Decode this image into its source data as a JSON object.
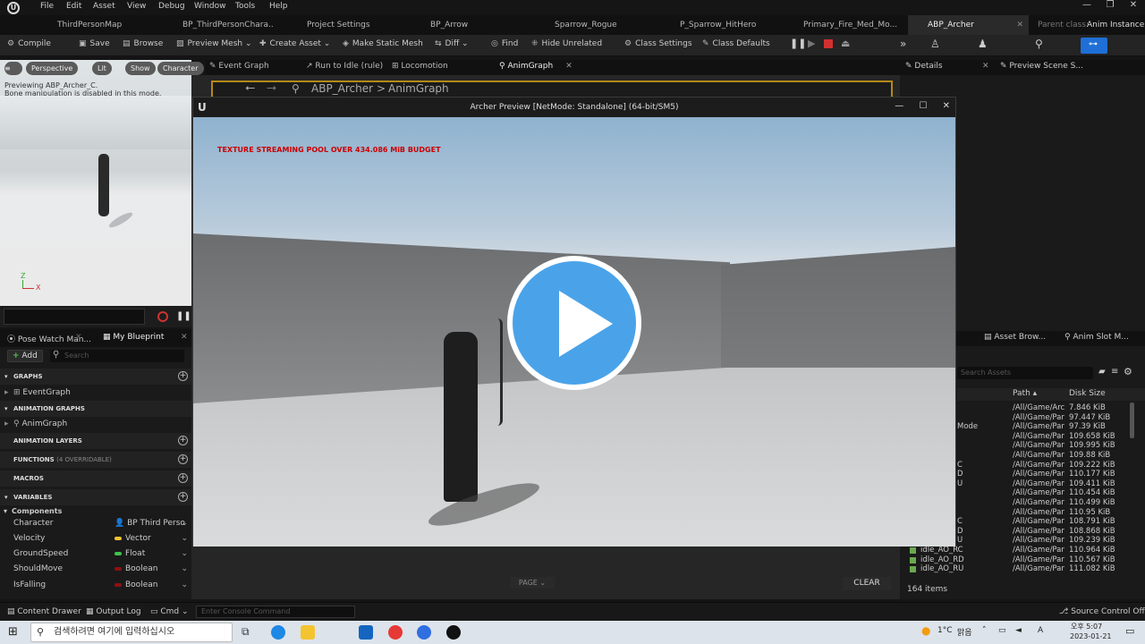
{
  "menu": {
    "items": [
      "File",
      "Edit",
      "Asset",
      "View",
      "Debug",
      "Window",
      "Tools",
      "Help"
    ]
  },
  "window_controls": {
    "minimize": "—",
    "maximize": "❐",
    "close": "✕"
  },
  "doc_tabs": [
    {
      "label": "ThirdPersonMap"
    },
    {
      "label": "BP_ThirdPersonChara..."
    },
    {
      "label": "Project Settings"
    },
    {
      "label": "BP_Arrow"
    },
    {
      "label": "Sparrow_Rogue"
    },
    {
      "label": "P_Sparrow_HitHero"
    },
    {
      "label": "Primary_Fire_Med_Mo..."
    },
    {
      "label": "ABP_Archer"
    }
  ],
  "parent_class": {
    "label": "Parent class:",
    "value": "Anim Instance"
  },
  "toolbar": {
    "compile": "Compile",
    "save": "Save",
    "browse": "Browse",
    "preview_mesh": "Preview Mesh",
    "create_asset": "Create Asset",
    "make_static_mesh": "Make Static Mesh",
    "diff": "Diff",
    "find": "Find",
    "hide_unrelated": "Hide Unrelated",
    "class_settings": "Class Settings",
    "class_defaults": "Class Defaults"
  },
  "viewport": {
    "perspective": "Perspective",
    "lit": "Lit",
    "show": "Show",
    "character": "Character",
    "line1": "Previewing ABP_Archer_C.",
    "line2": "Bone manipulation is disabled in this mode.",
    "axis_z": "Z",
    "axis_x": "X"
  },
  "left_panel": {
    "tabs": [
      "Pose Watch Man...",
      "My Blueprint"
    ],
    "add": "Add",
    "search_placeholder": "Search",
    "sections": {
      "graphs": "GRAPHS",
      "animation_graphs": "ANIMATION GRAPHS",
      "animation_layers": "ANIMATION LAYERS",
      "functions": "FUNCTIONS",
      "functions_sub": "(4 OVERRIDABLE)",
      "macros": "MACROS",
      "variables": "VARIABLES"
    },
    "event_graph": "EventGraph",
    "anim_graph": "AnimGraph",
    "components": "Components",
    "variables": [
      {
        "name": "Character",
        "type": "BP Third Perso",
        "color": "#3aa0e8"
      },
      {
        "name": "Velocity",
        "type": "Vector",
        "color": "#f2c132"
      },
      {
        "name": "GroundSpeed",
        "type": "Float",
        "color": "#3fc24a"
      },
      {
        "name": "ShouldMove",
        "type": "Boolean",
        "color": "#8c1212"
      },
      {
        "name": "IsFalling",
        "type": "Boolean",
        "color": "#8c1212"
      }
    ]
  },
  "graph_tabs": [
    "Event Graph",
    "Run to Idle (rule)",
    "Locomotion",
    "AnimGraph"
  ],
  "breadcrumb": {
    "root": "ABP_Archer",
    "child": "AnimGraph",
    "sep": ">"
  },
  "preview": {
    "title": "Archer Preview [NetMode: Standalone]  (64-bit/SM5)",
    "warning": "TEXTURE STREAMING POOL OVER 434.086 MiB BUDGET"
  },
  "right_panel": {
    "tabs": [
      "Details",
      "Preview Scene S..."
    ]
  },
  "asset_panel": {
    "tabs": [
      "Asset Brow...",
      "Anim Slot M..."
    ],
    "search_placeholder": "Search Assets",
    "col_path": "Path",
    "col_size": "Disk Size",
    "rows": [
      {
        "name": "",
        "path": "/All/Game/Arc",
        "size": "7.846 KiB"
      },
      {
        "name": "",
        "path": "/All/Game/Par",
        "size": "97.447 KiB"
      },
      {
        "name": "Mode",
        "path": "/All/Game/Par",
        "size": "97.39 KiB"
      },
      {
        "name": "",
        "path": "/All/Game/Par",
        "size": "109.658 KiB"
      },
      {
        "name": "",
        "path": "/All/Game/Par",
        "size": "109.995 KiB"
      },
      {
        "name": "",
        "path": "/All/Game/Par",
        "size": "109.88 KiB"
      },
      {
        "name": "C",
        "path": "/All/Game/Par",
        "size": "109.222 KiB"
      },
      {
        "name": "D",
        "path": "/All/Game/Par",
        "size": "110.177 KiB"
      },
      {
        "name": "U",
        "path": "/All/Game/Par",
        "size": "109.411 KiB"
      },
      {
        "name": "",
        "path": "/All/Game/Par",
        "size": "110.454 KiB"
      },
      {
        "name": "",
        "path": "/All/Game/Par",
        "size": "110.499 KiB"
      },
      {
        "name": "",
        "path": "/All/Game/Par",
        "size": "110.95 KiB"
      },
      {
        "name": "C",
        "path": "/All/Game/Par",
        "size": "108.791 KiB"
      },
      {
        "name": "D",
        "path": "/All/Game/Par",
        "size": "108.868 KiB"
      },
      {
        "name": "U",
        "path": "/All/Game/Par",
        "size": "109.239 KiB"
      },
      {
        "name": "idle_AO_RC",
        "path": "/All/Game/Par",
        "size": "110.964 KiB"
      },
      {
        "name": "idle_AO_RD",
        "path": "/All/Game/Par",
        "size": "110.567 KiB"
      },
      {
        "name": "idle_AO_RU",
        "path": "/All/Game/Par",
        "size": "111.082 KiB"
      }
    ],
    "count": "164 items"
  },
  "bottom": {
    "page": "PAGE",
    "clear": "CLEAR"
  },
  "statusbar": {
    "content_drawer": "Content Drawer",
    "output_log": "Output Log",
    "cmd": "Cmd",
    "console_placeholder": "Enter Console Command",
    "source_control": "Source Control Off"
  },
  "taskbar": {
    "search": "검색하려면 여기에 입력하십시오",
    "temp": "1°C",
    "weather": "맑음",
    "lang": "A",
    "time": "오후 5:07",
    "date": "2023-01-21"
  }
}
